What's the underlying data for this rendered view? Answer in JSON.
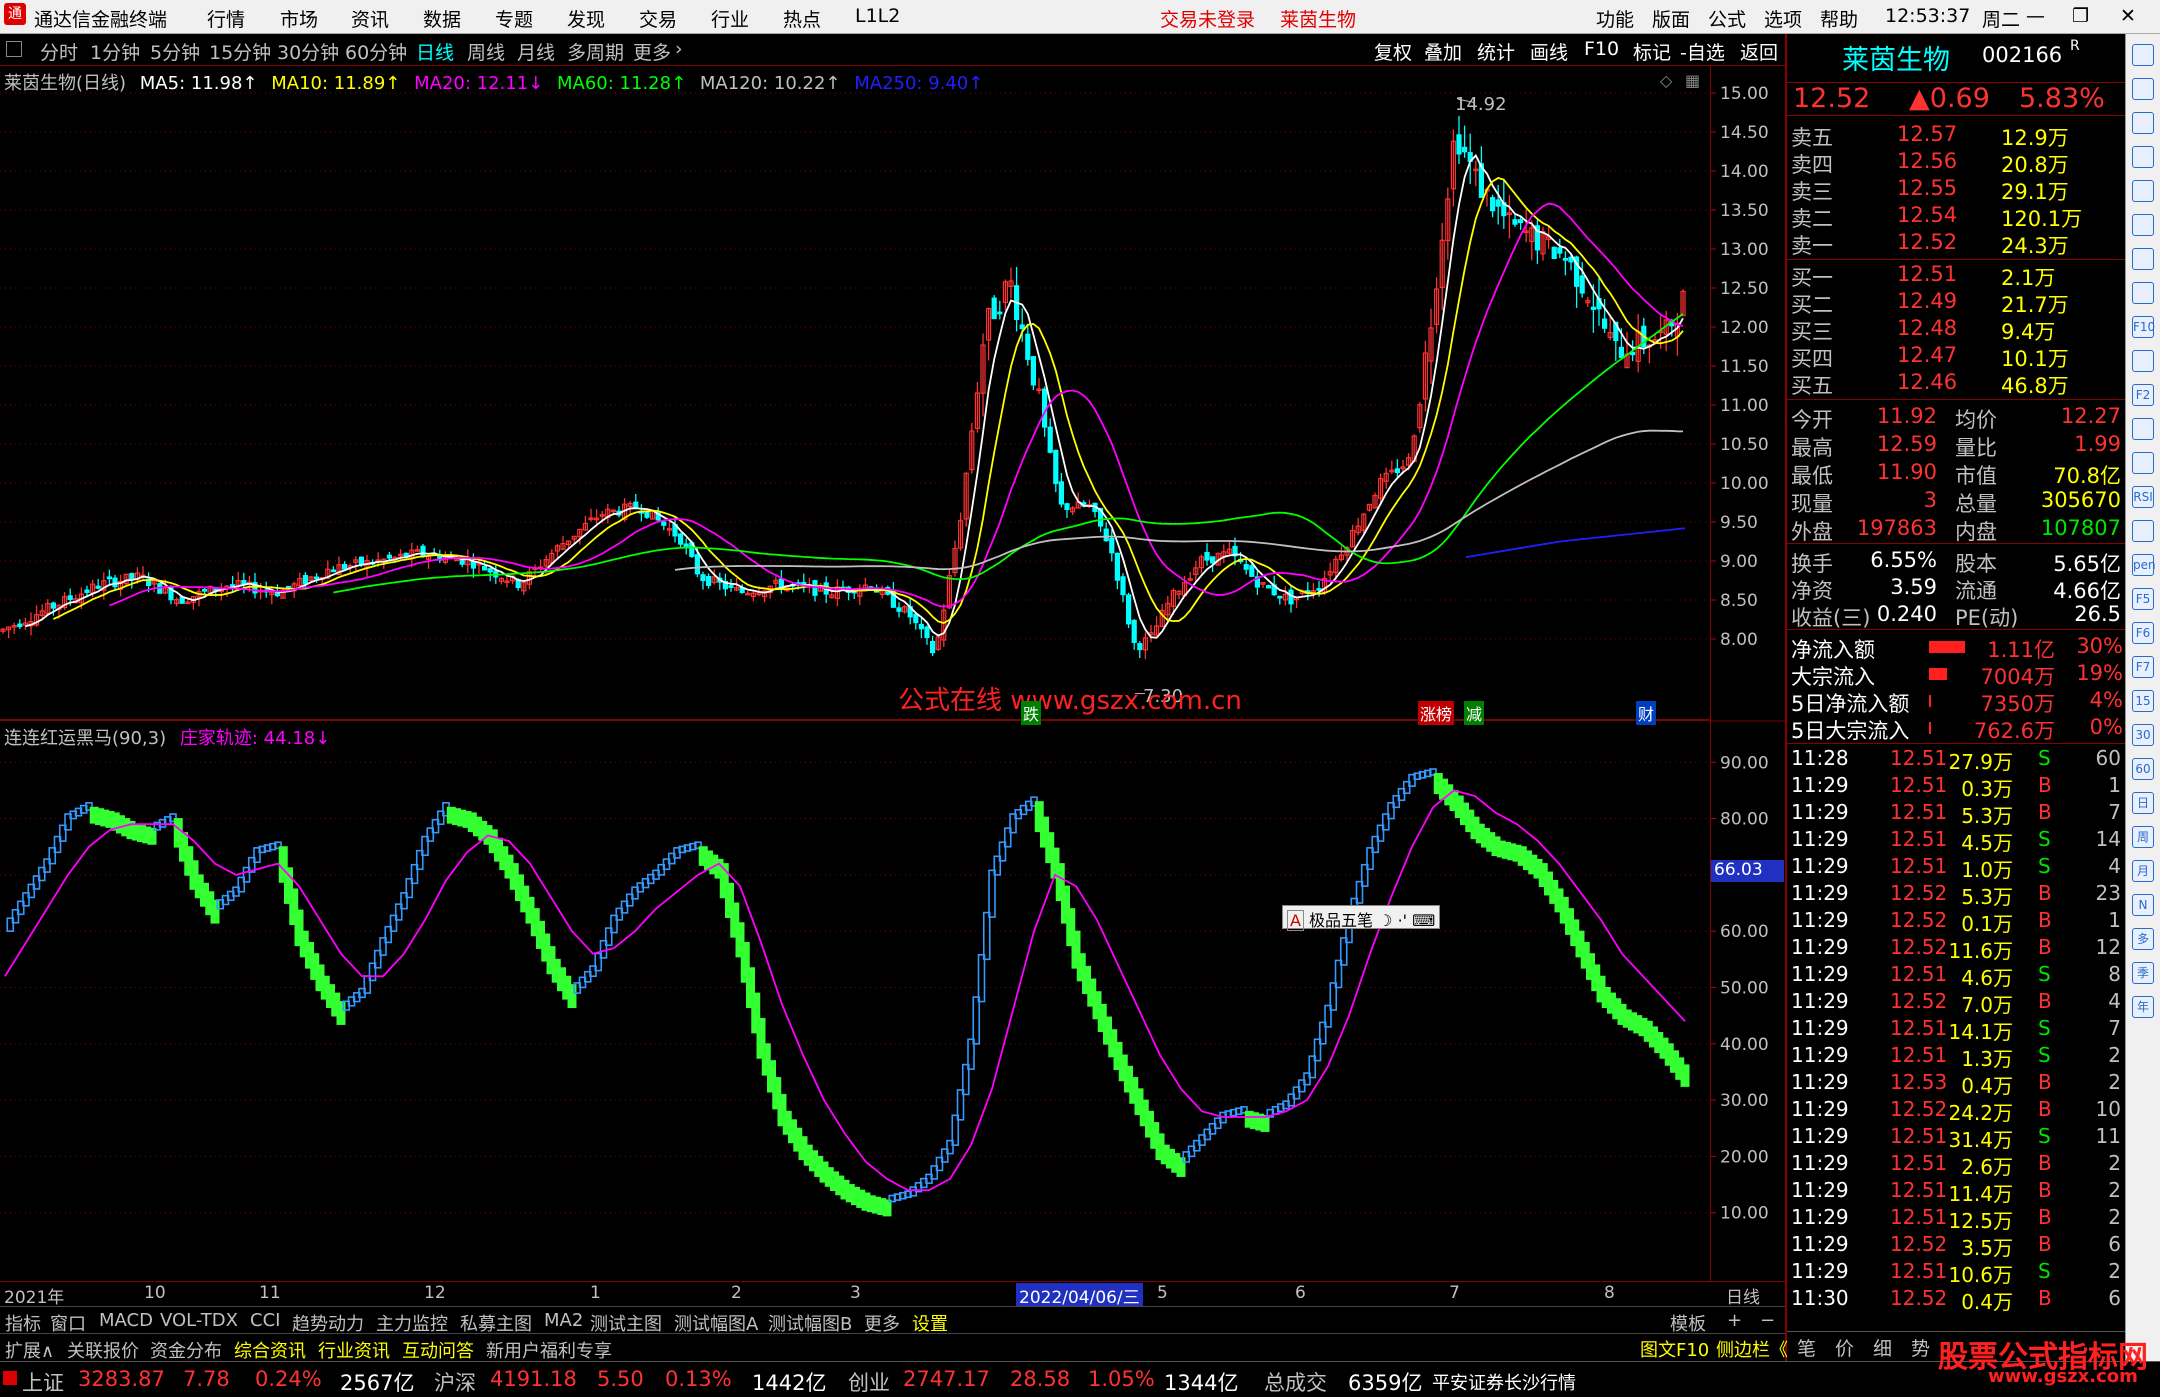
{
  "window": {
    "app_title": "通达信金融终端",
    "menus": [
      "行情",
      "市场",
      "资讯",
      "数据",
      "专题",
      "发现",
      "交易",
      "行业",
      "热点",
      "L1L2"
    ],
    "status_login": "交易未登录",
    "stock_name_top": "莱茵生物",
    "right_menus": [
      "功能",
      "版面",
      "公式",
      "选项",
      "帮助"
    ],
    "clock": "12:53:37",
    "weekday": "周二"
  },
  "periods": [
    "分时",
    "1分钟",
    "5分钟",
    "15分钟",
    "30分钟",
    "60分钟",
    "日线",
    "周线",
    "月线",
    "多周期",
    "更多"
  ],
  "active_period": "日线",
  "tools": [
    "复权",
    "叠加",
    "统计",
    "画线",
    "F10",
    "标记",
    "-自选",
    "返回"
  ],
  "main_chart": {
    "legend": [
      {
        "label": "莱茵生物(日线)",
        "color": "#c0c0c0"
      },
      {
        "label": "MA5: 11.98↑",
        "color": "#ffffff"
      },
      {
        "label": "MA10: 11.89↑",
        "color": "#ffff00"
      },
      {
        "label": "MA20: 12.11↓",
        "color": "#ff00ff"
      },
      {
        "label": "MA60: 11.28↑",
        "color": "#00ff00"
      },
      {
        "label": "MA120: 10.22↑",
        "color": "#c0c0c0"
      },
      {
        "label": "MA250: 9.40↑",
        "color": "#2020ff"
      }
    ],
    "high_label": "14.92",
    "low_label": "7.30",
    "watermark": "公式在线 www.gszx.com.cn",
    "markers": [
      "跌",
      "涨榜",
      "减",
      "财"
    ],
    "y_ticks": [
      "15.00",
      "14.50",
      "14.00",
      "13.50",
      "13.00",
      "12.50",
      "12.00",
      "11.50",
      "11.00",
      "10.50",
      "10.00",
      "9.50",
      "9.00",
      "8.50",
      "8.00"
    ]
  },
  "chart_data": {
    "type": "line",
    "title": "连连红运黑马(90,3)",
    "series": [
      {
        "name": "庄家轨迹",
        "last": 44.18,
        "values": [
          60,
          66,
          72,
          80,
          82,
          81,
          79,
          78,
          80,
          70,
          64,
          67,
          74,
          75,
          60,
          52,
          46,
          49,
          58,
          66,
          76,
          82,
          81,
          78,
          72,
          64,
          55,
          49,
          53,
          62,
          67,
          70,
          74,
          75,
          72,
          58,
          40,
          28,
          22,
          18,
          15,
          13,
          12,
          13,
          16,
          22,
          40,
          70,
          80,
          83,
          72,
          56,
          47,
          38,
          30,
          22,
          19,
          23,
          27,
          28,
          27,
          29,
          34,
          46,
          62,
          74,
          82,
          87,
          88,
          84,
          79,
          76,
          75,
          72,
          66,
          58,
          50,
          46,
          44,
          40,
          35
        ]
      },
      {
        "name": "MA",
        "values": [
          52,
          58,
          64,
          70,
          75,
          78,
          79,
          79,
          79,
          76,
          72,
          70,
          71,
          72,
          68,
          62,
          56,
          52,
          52,
          56,
          62,
          69,
          74,
          77,
          76,
          72,
          66,
          60,
          56,
          57,
          60,
          64,
          67,
          70,
          72,
          68,
          58,
          47,
          38,
          30,
          24,
          19,
          16,
          14,
          14,
          16,
          22,
          32,
          46,
          60,
          70,
          68,
          62,
          54,
          46,
          38,
          32,
          28,
          27,
          27,
          27,
          28,
          30,
          36,
          45,
          56,
          66,
          75,
          82,
          85,
          84,
          81,
          79,
          76,
          72,
          67,
          62,
          56,
          52,
          48,
          44
        ]
      }
    ],
    "ylim": [
      0,
      92
    ],
    "y_ticks": [
      "90.00",
      "80.00",
      "70.00",
      "60.00",
      "50.00",
      "40.00",
      "30.00",
      "20.00",
      "10.00"
    ],
    "cursor_value": "66.03"
  },
  "popup": {
    "label": "极品五笔"
  },
  "time_axis": [
    "2021年",
    "10",
    "11",
    "12",
    "1",
    "2",
    "3",
    "2022/04/06/三",
    "5",
    "6",
    "7",
    "8"
  ],
  "time_axis_right": "日线",
  "tabs_row1": [
    "指标",
    "窗口",
    "MACD",
    "VOL-TDX",
    "CCI",
    "趋势动力",
    "主力监控",
    "私募主图",
    "MA2",
    "测试主图",
    "测试幅图A",
    "测试幅图B",
    "更多",
    "设置"
  ],
  "tabs_row1_right": "模板",
  "tabs_row2": [
    "扩展∧",
    "关联报价",
    "资金分布",
    "综合资讯",
    "行业资讯",
    "互动问答",
    "新用户福利专享"
  ],
  "quote": {
    "name": "莱茵生物",
    "code": "002166",
    "tag": "R",
    "price": "12.52",
    "change": "▲0.69",
    "pct": "5.83%",
    "asks": [
      {
        "label": "卖五",
        "price": "12.57",
        "vol": "12.9万"
      },
      {
        "label": "卖四",
        "price": "12.56",
        "vol": "20.8万"
      },
      {
        "label": "卖三",
        "price": "12.55",
        "vol": "29.1万"
      },
      {
        "label": "卖二",
        "price": "12.54",
        "vol": "120.1万"
      },
      {
        "label": "卖一",
        "price": "12.52",
        "vol": "24.3万"
      }
    ],
    "bids": [
      {
        "label": "买一",
        "price": "12.51",
        "vol": "2.1万"
      },
      {
        "label": "买二",
        "price": "12.49",
        "vol": "21.7万"
      },
      {
        "label": "买三",
        "price": "12.48",
        "vol": "9.4万"
      },
      {
        "label": "买四",
        "price": "12.47",
        "vol": "10.1万"
      },
      {
        "label": "买五",
        "price": "12.46",
        "vol": "46.8万"
      }
    ],
    "stats": [
      {
        "l1": "今开",
        "v1": "11.92",
        "l2": "均价",
        "v2": "12.27"
      },
      {
        "l1": "最高",
        "v1": "12.59",
        "l2": "量比",
        "v2": "1.99"
      },
      {
        "l1": "最低",
        "v1": "11.90",
        "l2": "市值",
        "v2": "70.8亿"
      },
      {
        "l1": "现量",
        "v1": "3",
        "l2": "总量",
        "v2": "305670"
      },
      {
        "l1": "外盘",
        "v1": "197863",
        "l2": "内盘",
        "v2": "107807"
      }
    ],
    "fund": [
      {
        "l1": "换手",
        "v1": "6.55%",
        "l2": "股本",
        "v2": "5.65亿"
      },
      {
        "l1": "净资",
        "v1": "3.59",
        "l2": "流通",
        "v2": "4.66亿"
      },
      {
        "l1": "收益(三)",
        "v1": "0.240",
        "l2": "PE(动)",
        "v2": "26.5"
      }
    ],
    "flows": [
      {
        "label": "净流入额",
        "value": "1.11亿",
        "pct": "30%"
      },
      {
        "label": "大宗流入",
        "value": "7004万",
        "pct": "19%"
      },
      {
        "label": "5日净流入额",
        "value": "7350万",
        "pct": "4%"
      },
      {
        "label": "5日大宗流入",
        "value": "762.6万",
        "pct": "0%"
      }
    ],
    "trades": [
      [
        "11:28",
        "12.51",
        "27.9万",
        "S",
        "60"
      ],
      [
        "11:29",
        "12.51",
        "0.3万",
        "B",
        "1"
      ],
      [
        "11:29",
        "12.51",
        "5.3万",
        "B",
        "7"
      ],
      [
        "11:29",
        "12.51",
        "4.5万",
        "S",
        "14"
      ],
      [
        "11:29",
        "12.51",
        "1.0万",
        "S",
        "4"
      ],
      [
        "11:29",
        "12.52",
        "5.3万",
        "B",
        "23"
      ],
      [
        "11:29",
        "12.52",
        "0.1万",
        "B",
        "1"
      ],
      [
        "11:29",
        "12.52",
        "11.6万",
        "B",
        "12"
      ],
      [
        "11:29",
        "12.51",
        "4.6万",
        "S",
        "8"
      ],
      [
        "11:29",
        "12.52",
        "7.0万",
        "B",
        "4"
      ],
      [
        "11:29",
        "12.51",
        "14.1万",
        "S",
        "7"
      ],
      [
        "11:29",
        "12.51",
        "1.3万",
        "S",
        "2"
      ],
      [
        "11:29",
        "12.53",
        "0.4万",
        "B",
        "2"
      ],
      [
        "11:29",
        "12.52",
        "24.2万",
        "B",
        "10"
      ],
      [
        "11:29",
        "12.51",
        "31.4万",
        "S",
        "11"
      ],
      [
        "11:29",
        "12.51",
        "2.6万",
        "B",
        "2"
      ],
      [
        "11:29",
        "12.51",
        "11.4万",
        "B",
        "2"
      ],
      [
        "11:29",
        "12.51",
        "12.5万",
        "B",
        "2"
      ],
      [
        "11:29",
        "12.52",
        "3.5万",
        "B",
        "6"
      ],
      [
        "11:29",
        "12.51",
        "10.6万",
        "S",
        "2"
      ],
      [
        "11:30",
        "12.52",
        "0.4万",
        "B",
        "6"
      ]
    ],
    "bottom_tabs": [
      "笔",
      "价",
      "细",
      "势"
    ]
  },
  "status": {
    "indices": [
      {
        "name": "上证",
        "value": "3283.87",
        "chg": "7.78",
        "pct": "0.24%",
        "amt": "2567亿"
      },
      {
        "name": "沪深",
        "value": "4191.18",
        "chg": "5.50",
        "pct": "0.13%",
        "amt": "1442亿"
      },
      {
        "name": "创业",
        "value": "2747.17",
        "chg": "28.58",
        "pct": "1.05%",
        "amt": "1344亿"
      }
    ],
    "total_label": "总成交",
    "total_value": "6359亿",
    "broker": "平安证券长沙行情",
    "f10": "图文F10",
    "sidebar": "侧边栏《",
    "site_logo": "股票公式指标网",
    "site_url": "www.gszx.com"
  },
  "right_icons": [
    "up-arrow",
    "down-arrow",
    "table",
    "bars",
    "line",
    "candle",
    "kline",
    "fund",
    "F10",
    "list",
    "F2",
    "circle",
    "chart",
    "RSI",
    "move",
    "pen",
    "F5",
    "F6",
    "F7",
    "15",
    "30",
    "60",
    "日",
    "周",
    "月",
    "N",
    "多",
    "季",
    "年"
  ]
}
